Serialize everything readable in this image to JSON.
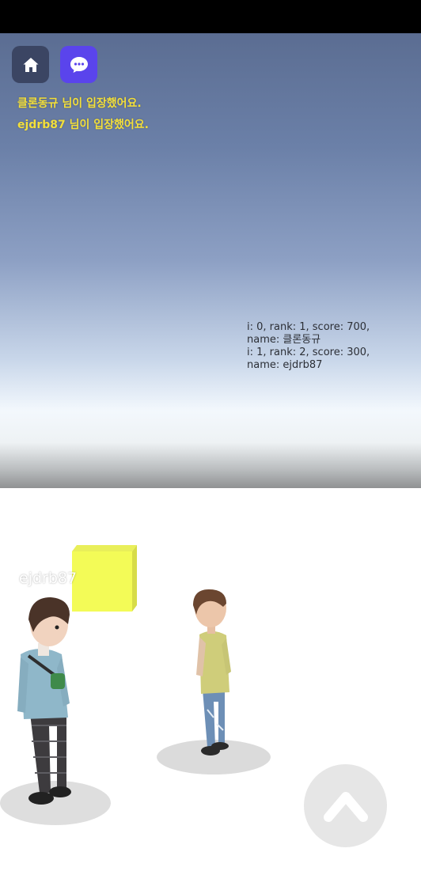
{
  "toolbar": {
    "home_icon": "home-icon",
    "chat_icon": "chat-bubble-icon"
  },
  "chat_log": [
    "클론동규 님이 입장했어요.",
    "ejdrb87 님이 입장했어요."
  ],
  "rankings": [
    {
      "line1": "i: 0, rank: 1, score: 700,",
      "line2": "name: 클론동규"
    },
    {
      "line1": "i: 1, rank: 2, score: 300,",
      "line2": "name: ejdrb87"
    }
  ],
  "player_name_tag": "ejdrb87",
  "controls": {
    "jump_icon": "chevron-up-icon"
  },
  "colors": {
    "chat_text": "#f3df3a",
    "chat_button": "#5a44ec",
    "home_button": "#3b4563",
    "cube": "#f3fb57"
  }
}
